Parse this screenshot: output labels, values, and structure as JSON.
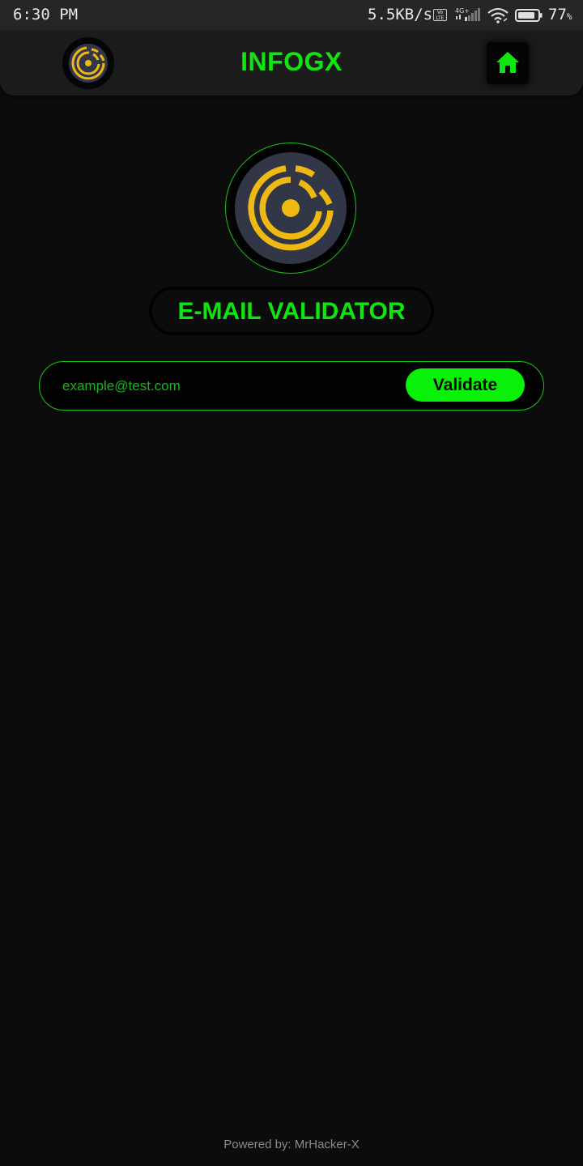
{
  "status_bar": {
    "time": "6:30 PM",
    "net_speed": "5.5KB/s",
    "volte_badge": "Vo LTE",
    "network_type": "4G+",
    "battery_level": "77",
    "battery_unit": "%"
  },
  "app_bar": {
    "title": "INFOGX",
    "home_icon": "home-icon",
    "logo_icon": "infogx-logo-icon"
  },
  "main": {
    "heading": "E-MAIL VALIDATOR",
    "email_input": {
      "value": "",
      "placeholder": "example@test.com"
    },
    "validate_label": "Validate"
  },
  "footer": {
    "text": "Powered by: MrHacker-X"
  },
  "colors": {
    "accent_green": "#0fe60f",
    "logo_yellow": "#f0b912",
    "logo_bg": "#323748",
    "background": "#0c0c0c"
  }
}
